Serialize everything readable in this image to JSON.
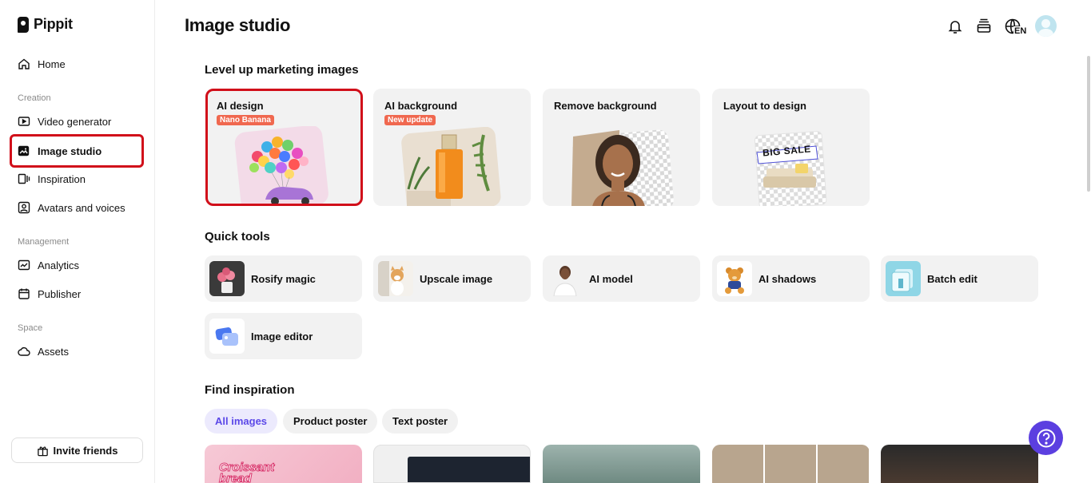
{
  "app": {
    "name": "Pippit"
  },
  "sidebar": {
    "home": "Home",
    "sections": {
      "creation": "Creation",
      "management": "Management",
      "space": "Space"
    },
    "items": {
      "video_generator": "Video generator",
      "image_studio": "Image studio",
      "inspiration": "Inspiration",
      "avatars_voices": "Avatars and voices",
      "analytics": "Analytics",
      "publisher": "Publisher",
      "assets": "Assets"
    },
    "invite": "Invite friends"
  },
  "header": {
    "title": "Image studio",
    "language": "EN"
  },
  "marketing": {
    "heading": "Level up marketing images",
    "cards": [
      {
        "title": "AI design",
        "badge": "Nano Banana"
      },
      {
        "title": "AI background",
        "badge": "New update"
      },
      {
        "title": "Remove background"
      },
      {
        "title": "Layout to design",
        "sale_text": "BIG SALE"
      }
    ]
  },
  "quick_tools": {
    "heading": "Quick tools",
    "items": [
      "Rosify magic",
      "Upscale image",
      "AI model",
      "AI shadows",
      "Batch edit",
      "Image editor"
    ]
  },
  "inspiration": {
    "heading": "Find inspiration",
    "filters": [
      "All images",
      "Product poster",
      "Text poster"
    ],
    "active_filter": "All images",
    "first_card_text": "Croissant bread"
  },
  "colors": {
    "accent": "#5b3fe0",
    "highlight": "#d10f1a",
    "badge": "#f0684f"
  }
}
